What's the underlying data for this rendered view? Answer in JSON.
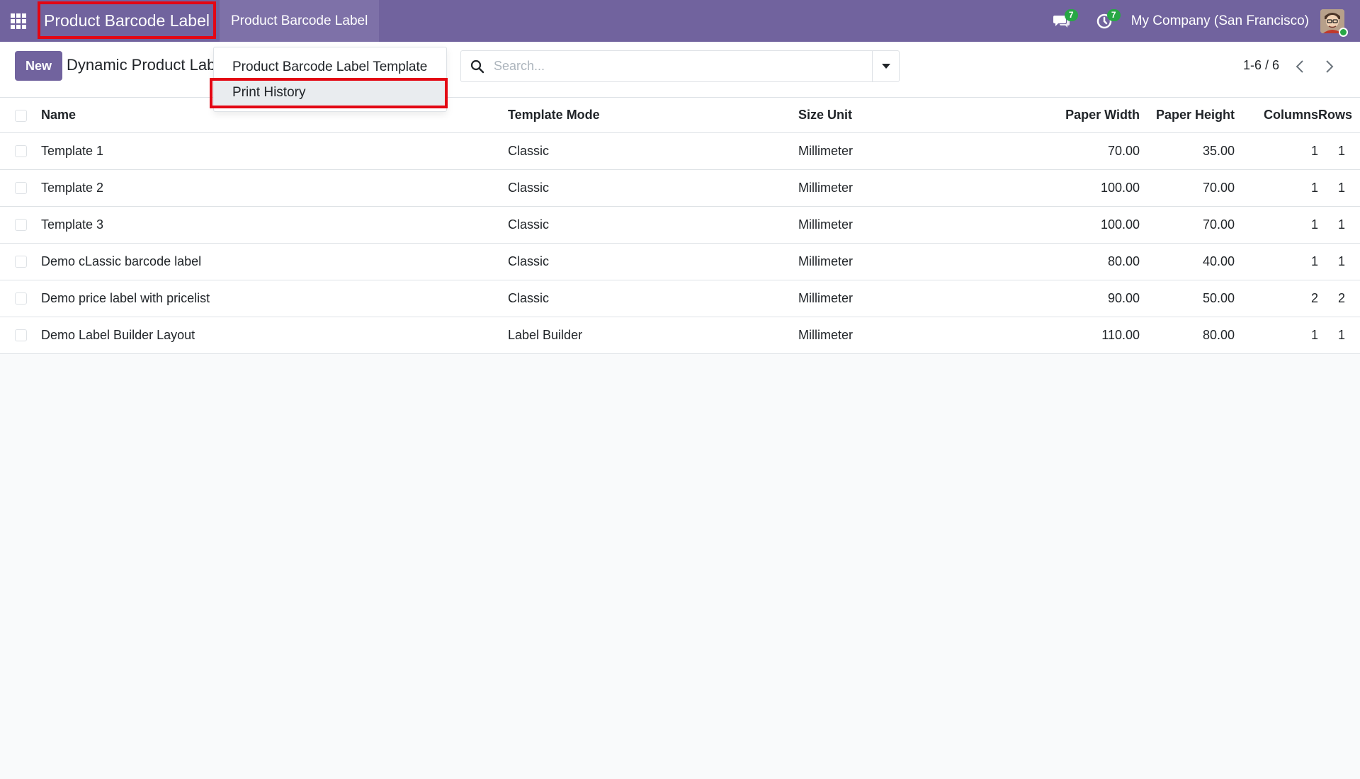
{
  "navbar": {
    "app_title": "Product Barcode Label",
    "top_menu": "Product Barcode Label",
    "messages_count": "7",
    "activities_count": "7",
    "company": "My Company (San Francisco)"
  },
  "control_panel": {
    "new_label": "New",
    "breadcrumb": "Dynamic Product Labels",
    "search_placeholder": "Search...",
    "pager": "1-6 / 6"
  },
  "dropdown": {
    "items": [
      {
        "label": "Product Barcode Label Template"
      },
      {
        "label": "Print History"
      }
    ]
  },
  "table": {
    "columns": [
      "Name",
      "Template Mode",
      "Size Unit",
      "Paper Width",
      "Paper Height",
      "Columns",
      "Rows"
    ],
    "rows": [
      {
        "name": "Template 1",
        "mode": "Classic",
        "unit": "Millimeter",
        "width": "70.00",
        "height": "35.00",
        "columns": "1",
        "rows": "1"
      },
      {
        "name": "Template 2",
        "mode": "Classic",
        "unit": "Millimeter",
        "width": "100.00",
        "height": "70.00",
        "columns": "1",
        "rows": "1"
      },
      {
        "name": "Template 3",
        "mode": "Classic",
        "unit": "Millimeter",
        "width": "100.00",
        "height": "70.00",
        "columns": "1",
        "rows": "1"
      },
      {
        "name": "Demo cLassic barcode label",
        "mode": "Classic",
        "unit": "Millimeter",
        "width": "80.00",
        "height": "40.00",
        "columns": "1",
        "rows": "1"
      },
      {
        "name": "Demo price label with pricelist",
        "mode": "Classic",
        "unit": "Millimeter",
        "width": "90.00",
        "height": "50.00",
        "columns": "2",
        "rows": "2"
      },
      {
        "name": "Demo Label Builder Layout",
        "mode": "Label Builder",
        "unit": "Millimeter",
        "width": "110.00",
        "height": "80.00",
        "columns": "1",
        "rows": "1"
      }
    ]
  },
  "colors": {
    "brand": "#71639e",
    "highlight": "#e30613",
    "badge": "#28a745"
  }
}
